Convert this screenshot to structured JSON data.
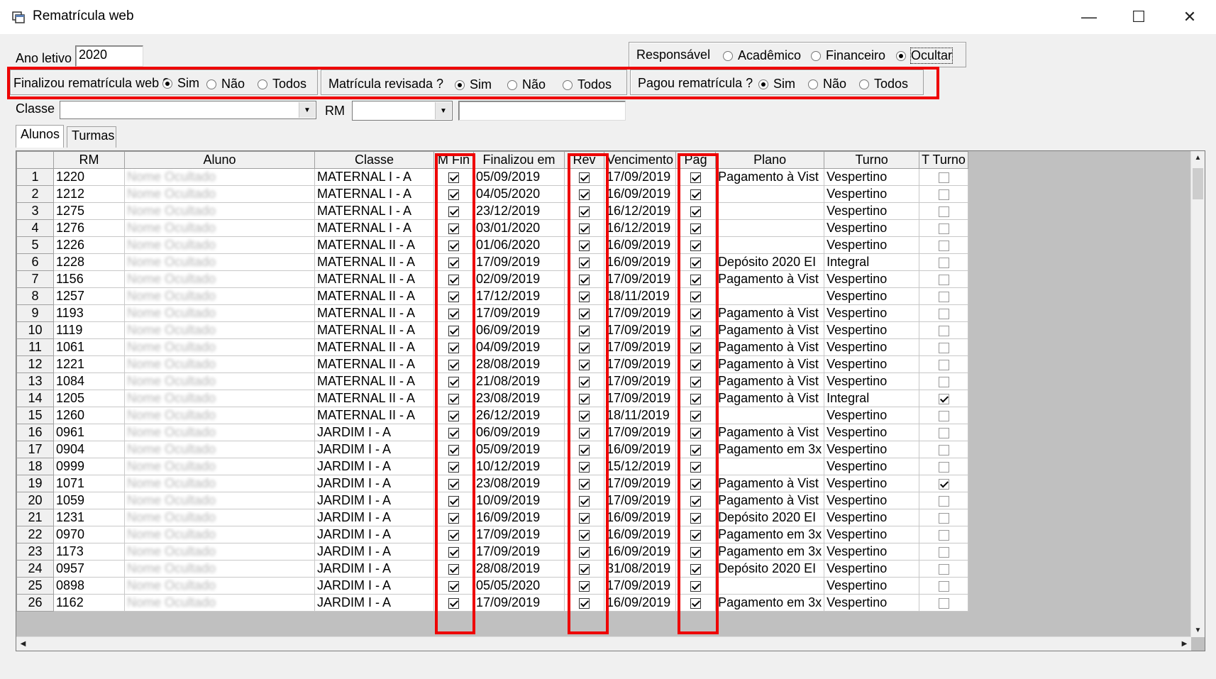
{
  "window": {
    "title": "Rematrícula web",
    "minimize": "—",
    "maximize": "☐",
    "close": "✕"
  },
  "filters": {
    "ano_letivo_label": "Ano letivo",
    "ano_letivo_value": "2020",
    "responsavel": {
      "label": "Responsável",
      "options": [
        "Acadêmico",
        "Financeiro",
        "Ocultar"
      ],
      "selected": "Ocultar"
    },
    "finalizou": {
      "label": "Finalizou rematrícula web ?",
      "options": [
        "Sim",
        "Não",
        "Todos"
      ],
      "selected": "Sim"
    },
    "revisada": {
      "label": "Matrícula revisada ?",
      "options": [
        "Sim",
        "Não",
        "Todos"
      ],
      "selected": "Sim"
    },
    "pagou": {
      "label": "Pagou rematrícula ?",
      "options": [
        "Sim",
        "Não",
        "Todos"
      ],
      "selected": "Sim"
    },
    "classe_label": "Classe",
    "classe_value": "",
    "rm_label": "RM",
    "rm_value": "",
    "search_value": ""
  },
  "tabs": [
    "Alunos",
    "Turmas"
  ],
  "grid": {
    "columns": [
      "",
      "RM",
      "Aluno",
      "Classe",
      "M Fin",
      "Finalizou em",
      "Rev",
      "Vencimento",
      "Pag",
      "Plano",
      "Turno",
      "T Turno"
    ],
    "rows": [
      {
        "n": "1",
        "rm": "1220",
        "aluno": "Nome Ocultado",
        "classe": "MATERNAL I - A",
        "fin": "05/09/2019",
        "venc": "17/09/2019",
        "plano": "Pagamento à Vist",
        "turno": "Vespertino",
        "tturno": false
      },
      {
        "n": "2",
        "rm": "1212",
        "aluno": "Nome Ocultado",
        "classe": "MATERNAL I - A",
        "fin": "04/05/2020",
        "venc": "16/09/2019",
        "plano": "",
        "turno": "Vespertino",
        "tturno": false
      },
      {
        "n": "3",
        "rm": "1275",
        "aluno": "Nome Ocultado",
        "classe": "MATERNAL I - A",
        "fin": "23/12/2019",
        "venc": "16/12/2019",
        "plano": "",
        "turno": "Vespertino",
        "tturno": false
      },
      {
        "n": "4",
        "rm": "1276",
        "aluno": "Nome Ocultado",
        "classe": "MATERNAL I - A",
        "fin": "03/01/2020",
        "venc": "16/12/2019",
        "plano": "",
        "turno": "Vespertino",
        "tturno": false
      },
      {
        "n": "5",
        "rm": "1226",
        "aluno": "Nome Ocultado",
        "classe": "MATERNAL II - A",
        "fin": "01/06/2020",
        "venc": "16/09/2019",
        "plano": "",
        "turno": "Vespertino",
        "tturno": false
      },
      {
        "n": "6",
        "rm": "1228",
        "aluno": "Nome Ocultado",
        "classe": "MATERNAL II - A",
        "fin": "17/09/2019",
        "venc": "16/09/2019",
        "plano": "Depósito 2020 EI",
        "turno": "Integral",
        "tturno": false
      },
      {
        "n": "7",
        "rm": "1156",
        "aluno": "Nome Ocultado",
        "classe": "MATERNAL II - A",
        "fin": "02/09/2019",
        "venc": "17/09/2019",
        "plano": "Pagamento à Vist",
        "turno": "Vespertino",
        "tturno": false
      },
      {
        "n": "8",
        "rm": "1257",
        "aluno": "Nome Ocultado",
        "classe": "MATERNAL II - A",
        "fin": "17/12/2019",
        "venc": "18/11/2019",
        "plano": "",
        "turno": "Vespertino",
        "tturno": false
      },
      {
        "n": "9",
        "rm": "1193",
        "aluno": "Nome Ocultado",
        "classe": "MATERNAL II - A",
        "fin": "17/09/2019",
        "venc": "17/09/2019",
        "plano": "Pagamento à Vist",
        "turno": "Vespertino",
        "tturno": false
      },
      {
        "n": "10",
        "rm": "1119",
        "aluno": "Nome Ocultado",
        "classe": "MATERNAL II - A",
        "fin": "06/09/2019",
        "venc": "17/09/2019",
        "plano": "Pagamento à Vist",
        "turno": "Vespertino",
        "tturno": false
      },
      {
        "n": "11",
        "rm": "1061",
        "aluno": "Nome Ocultado",
        "classe": "MATERNAL II - A",
        "fin": "04/09/2019",
        "venc": "17/09/2019",
        "plano": "Pagamento à Vist",
        "turno": "Vespertino",
        "tturno": false
      },
      {
        "n": "12",
        "rm": "1221",
        "aluno": "Nome Ocultado",
        "classe": "MATERNAL II - A",
        "fin": "28/08/2019",
        "venc": "17/09/2019",
        "plano": "Pagamento à Vist",
        "turno": "Vespertino",
        "tturno": false
      },
      {
        "n": "13",
        "rm": "1084",
        "aluno": "Nome Ocultado",
        "classe": "MATERNAL II - A",
        "fin": "21/08/2019",
        "venc": "17/09/2019",
        "plano": "Pagamento à Vist",
        "turno": "Vespertino",
        "tturno": false
      },
      {
        "n": "14",
        "rm": "1205",
        "aluno": "Nome Ocultado",
        "classe": "MATERNAL II - A",
        "fin": "23/08/2019",
        "venc": "17/09/2019",
        "plano": "Pagamento à Vist",
        "turno": "Integral",
        "tturno": true
      },
      {
        "n": "15",
        "rm": "1260",
        "aluno": "Nome Ocultado",
        "classe": "MATERNAL II - A",
        "fin": "26/12/2019",
        "venc": "18/11/2019",
        "plano": "",
        "turno": "Vespertino",
        "tturno": false
      },
      {
        "n": "16",
        "rm": "0961",
        "aluno": "Nome Ocultado",
        "classe": "JARDIM I - A",
        "fin": "06/09/2019",
        "venc": "17/09/2019",
        "plano": "Pagamento à Vist",
        "turno": "Vespertino",
        "tturno": false
      },
      {
        "n": "17",
        "rm": "0904",
        "aluno": "Nome Ocultado",
        "classe": "JARDIM I - A",
        "fin": "05/09/2019",
        "venc": "16/09/2019",
        "plano": "Pagamento em 3x",
        "turno": "Vespertino",
        "tturno": false
      },
      {
        "n": "18",
        "rm": "0999",
        "aluno": "Nome Ocultado",
        "classe": "JARDIM I - A",
        "fin": "10/12/2019",
        "venc": "15/12/2019",
        "plano": "",
        "turno": "Vespertino",
        "tturno": false
      },
      {
        "n": "19",
        "rm": "1071",
        "aluno": "Nome Ocultado",
        "classe": "JARDIM I - A",
        "fin": "23/08/2019",
        "venc": "17/09/2019",
        "plano": "Pagamento à Vist",
        "turno": "Vespertino",
        "tturno": true
      },
      {
        "n": "20",
        "rm": "1059",
        "aluno": "Nome Ocultado",
        "classe": "JARDIM I - A",
        "fin": "10/09/2019",
        "venc": "17/09/2019",
        "plano": "Pagamento à Vist",
        "turno": "Vespertino",
        "tturno": false
      },
      {
        "n": "21",
        "rm": "1231",
        "aluno": "Nome Ocultado",
        "classe": "JARDIM I - A",
        "fin": "16/09/2019",
        "venc": "16/09/2019",
        "plano": "Depósito 2020 EI",
        "turno": "Vespertino",
        "tturno": false
      },
      {
        "n": "22",
        "rm": "0970",
        "aluno": "Nome Ocultado",
        "classe": "JARDIM I - A",
        "fin": "17/09/2019",
        "venc": "16/09/2019",
        "plano": "Pagamento em 3x",
        "turno": "Vespertino",
        "tturno": false
      },
      {
        "n": "23",
        "rm": "1173",
        "aluno": "Nome Ocultado",
        "classe": "JARDIM I - A",
        "fin": "17/09/2019",
        "venc": "16/09/2019",
        "plano": "Pagamento em 3x",
        "turno": "Vespertino",
        "tturno": false
      },
      {
        "n": "24",
        "rm": "0957",
        "aluno": "Nome Ocultado",
        "classe": "JARDIM I - A",
        "fin": "28/08/2019",
        "venc": "31/08/2019",
        "plano": "Depósito 2020 EI",
        "turno": "Vespertino",
        "tturno": false
      },
      {
        "n": "25",
        "rm": "0898",
        "aluno": "Nome Ocultado",
        "classe": "JARDIM I - A",
        "fin": "05/05/2020",
        "venc": "17/09/2019",
        "plano": "",
        "turno": "Vespertino",
        "tturno": false
      },
      {
        "n": "26",
        "rm": "1162",
        "aluno": "Nome Ocultado",
        "classe": "JARDIM I - A",
        "fin": "17/09/2019",
        "venc": "16/09/2019",
        "plano": "Pagamento em 3x",
        "turno": "Vespertino",
        "tturno": false
      }
    ]
  },
  "colors": {
    "highlight": "#e00000",
    "window_bg": "#f0f0f0"
  },
  "icons": {
    "app": "app-window-icon",
    "dropdown": "chevron-down-icon"
  }
}
